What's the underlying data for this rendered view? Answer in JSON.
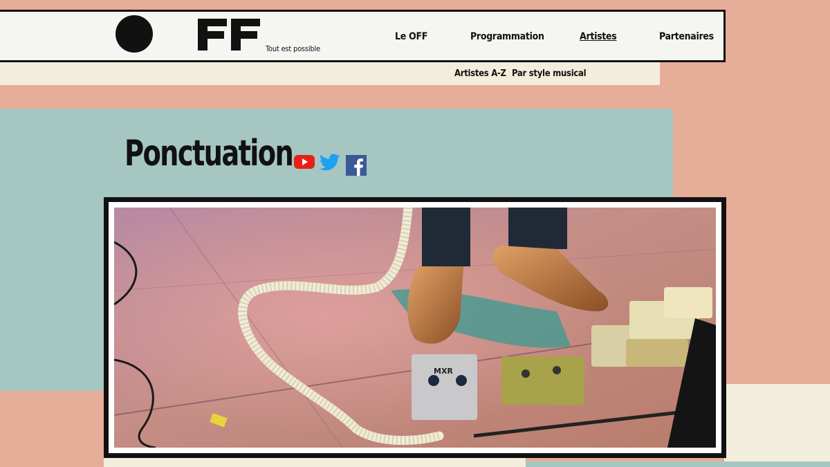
{
  "header": {
    "logo_text": "FF",
    "tagline": "Tout est possible",
    "nav": [
      {
        "label": "Le OFF",
        "active": false
      },
      {
        "label": "Programmation",
        "active": false
      },
      {
        "label": "Artistes",
        "active": true
      },
      {
        "label": "Partenaires",
        "active": false
      }
    ]
  },
  "subnav": {
    "items": [
      {
        "label": "Artistes A-Z"
      },
      {
        "label": "Par style musical"
      }
    ]
  },
  "artist": {
    "name": "Ponctuation",
    "social": [
      {
        "icon": "youtube-icon",
        "color": "#e62117"
      },
      {
        "icon": "twitter-icon",
        "color": "#1da1f2"
      },
      {
        "icon": "facebook-icon",
        "color": "#3b5998"
      }
    ],
    "photo_pedal_label": "MXR"
  },
  "colors": {
    "background": "#e6ad98",
    "teal": "#a6c6c1",
    "cream": "#f3eedc",
    "header_bg": "#f5f5f1",
    "ink": "#111111"
  }
}
